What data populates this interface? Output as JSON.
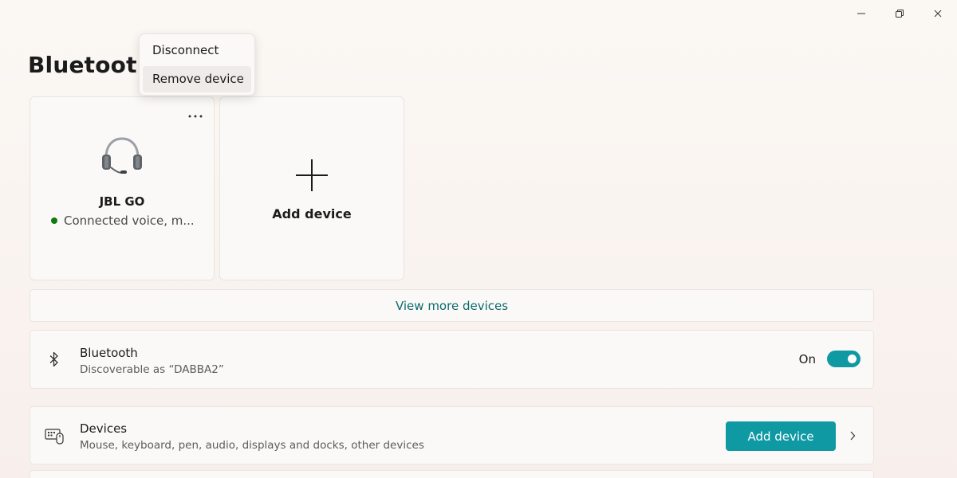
{
  "window": {
    "title": "Bluetooth"
  },
  "caption_buttons": {
    "minimize_icon": "minimize-icon",
    "restore_icon": "restore-icon",
    "close_icon": "close-icon"
  },
  "tiles": {
    "paired_device": {
      "name": "JBL GO",
      "status": "Connected voice, m...",
      "status_color": "#0f7b0f",
      "icon": "headset-icon",
      "more_icon": "more-horizontal-icon"
    },
    "add_device": {
      "label": "Add device",
      "icon": "plus-icon"
    }
  },
  "context_menu": {
    "items": [
      {
        "label": "Disconnect"
      },
      {
        "label": "Remove device"
      }
    ]
  },
  "view_more": {
    "label": "View more devices"
  },
  "bluetooth_row": {
    "icon": "bluetooth-icon",
    "title": "Bluetooth",
    "subtitle": "Discoverable as “DABBA2”",
    "toggle_label": "On",
    "toggle_on": true
  },
  "devices_row": {
    "icon": "devices-keyboard-icon",
    "title": "Devices",
    "subtitle": "Mouse, keyboard, pen, audio, displays and docks, other devices",
    "button_label": "Add device",
    "chevron_icon": "chevron-right-icon"
  },
  "colors": {
    "accent": "#0f9aa3",
    "link": "#0d6b6e",
    "connected": "#0f7b0f"
  }
}
